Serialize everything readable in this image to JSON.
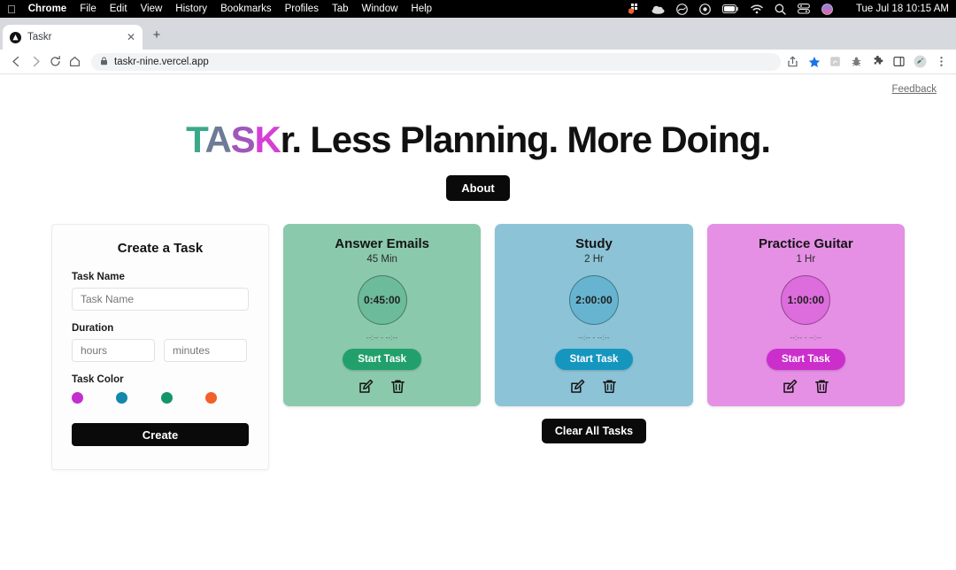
{
  "menubar": {
    "apple_icon": "apple-logo-icon",
    "items": [
      {
        "label": "Chrome",
        "bold": true
      },
      {
        "label": "File",
        "bold": false
      },
      {
        "label": "Edit",
        "bold": false
      },
      {
        "label": "View",
        "bold": false
      },
      {
        "label": "History",
        "bold": false
      },
      {
        "label": "Bookmarks",
        "bold": false
      },
      {
        "label": "Profiles",
        "bold": false
      },
      {
        "label": "Tab",
        "bold": false
      },
      {
        "label": "Window",
        "bold": false
      },
      {
        "label": "Help",
        "bold": false
      }
    ],
    "tray_icons": [
      "grid-badge-icon",
      "cloud-icon",
      "stats-icon",
      "record-icon",
      "battery-icon",
      "wifi-icon",
      "search-icon",
      "control-center-icon",
      "siri-icon"
    ],
    "clock": "Tue Jul 18  10:15 AM"
  },
  "browser": {
    "tab": {
      "title": "Taskr",
      "favicon": "taskr-drop-icon",
      "close_icon": "close-icon"
    },
    "new_tab_label": "+",
    "nav": {
      "back_icon": "back-arrow-icon",
      "forward_icon": "forward-arrow-icon",
      "reload_icon": "reload-icon",
      "home_icon": "home-icon"
    },
    "omnibox": {
      "lock_icon": "lock-icon",
      "url": "taskr-nine.vercel.app"
    },
    "toolbar_icons": [
      "share-icon",
      "bookmark-star-icon",
      "extension-reading-icon",
      "extension-bug-icon",
      "extensions-puzzle-icon",
      "side-panel-icon",
      "profile-avatar-icon",
      "chrome-menu-icon"
    ]
  },
  "page": {
    "feedback_link": "Feedback",
    "hero": {
      "brand_parts": [
        {
          "text": "T",
          "color": "#3aa98a"
        },
        {
          "text": "A",
          "color": "#6d7b96"
        },
        {
          "text": "S",
          "color": "#a057ba"
        },
        {
          "text": "K",
          "color": "#d63fd6"
        }
      ],
      "tagline": "r. Less Planning. More Doing.",
      "about_button": "About"
    },
    "create_form": {
      "title": "Create a Task",
      "task_name_label": "Task Name",
      "task_name_placeholder": "Task Name",
      "task_name_value": "",
      "duration_label": "Duration",
      "hours_placeholder": "hours",
      "hours_value": "",
      "minutes_placeholder": "minutes",
      "minutes_value": "",
      "task_color_label": "Task Color",
      "colors": [
        "#c42ed0",
        "#1288ab",
        "#14956b",
        "#f25f28"
      ],
      "create_button": "Create"
    },
    "tasks": [
      {
        "name": "Answer Emails",
        "duration": "45 Min",
        "timer": "0:45:00",
        "time_range": "--:-- - --:--",
        "start_button": "Start Task",
        "card_color": "#8bc9ac",
        "circle_color": "#6cbb9a",
        "button_color": "#22a06b",
        "edit_icon": "edit-pencil-icon",
        "delete_icon": "trash-icon"
      },
      {
        "name": "Study",
        "duration": "2 Hr",
        "timer": "2:00:00",
        "time_range": "--:-- - --:--",
        "start_button": "Start Task",
        "card_color": "#8cc3d6",
        "circle_color": "#66b4cf",
        "button_color": "#1596bf",
        "edit_icon": "edit-pencil-icon",
        "delete_icon": "trash-icon"
      },
      {
        "name": "Practice Guitar",
        "duration": "1 Hr",
        "timer": "1:00:00",
        "time_range": "--:-- - --:--",
        "start_button": "Start Task",
        "card_color": "#e58fe5",
        "circle_color": "#dd6cdd",
        "button_color": "#cc2ecc",
        "edit_icon": "edit-pencil-icon",
        "delete_icon": "trash-icon"
      }
    ],
    "clear_all_button": "Clear All Tasks"
  }
}
